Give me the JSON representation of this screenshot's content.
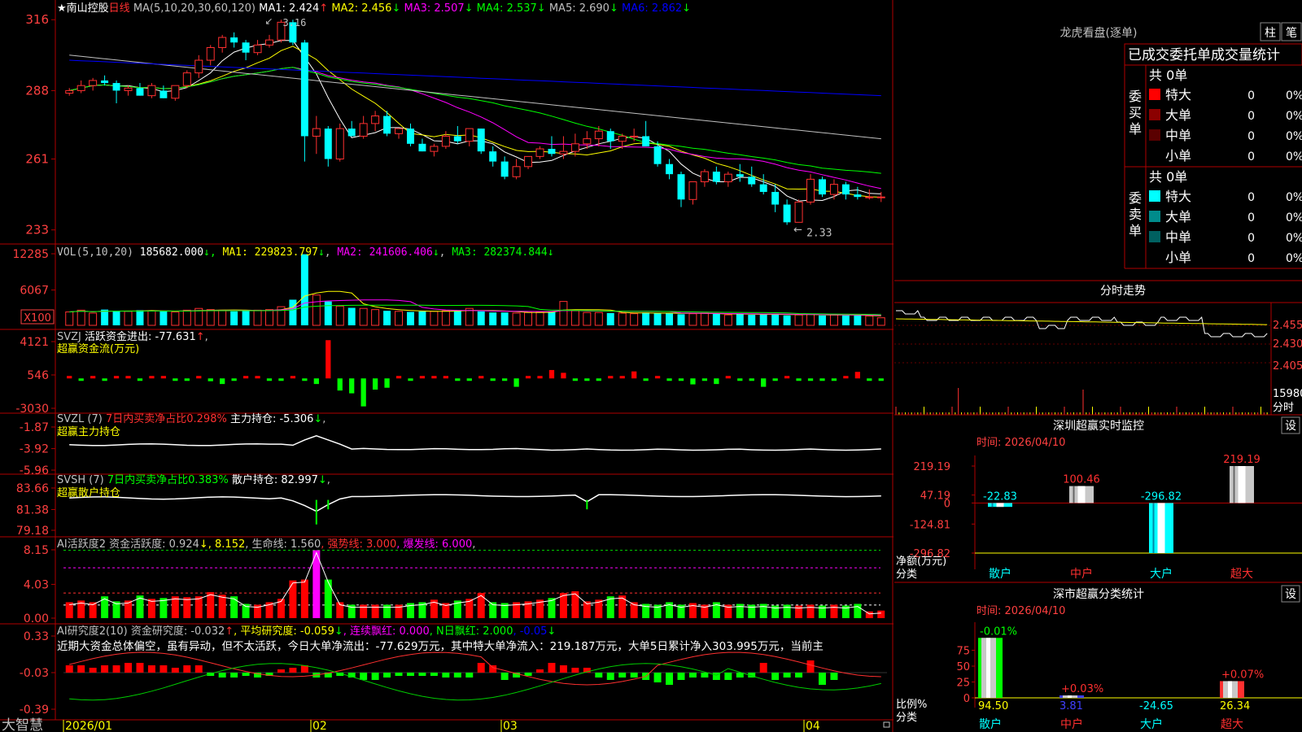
{
  "stock": {
    "name": "南山控股",
    "period": "日线",
    "star": "★"
  },
  "ma_header": {
    "label": "MA(5,10,20,30,60,120)",
    "items": [
      {
        "name": "MA1",
        "value": "2.424",
        "dir": "↑",
        "color": "#ffffff"
      },
      {
        "name": "MA2",
        "value": "2.456",
        "dir": "↓",
        "color": "#ffff00"
      },
      {
        "name": "MA3",
        "value": "2.507",
        "dir": "↓",
        "color": "#ff00ff"
      },
      {
        "name": "MA4",
        "value": "2.537",
        "dir": "↓",
        "color": "#00ff00"
      },
      {
        "name": "MA5",
        "value": "2.690",
        "dir": "↓",
        "color": "#c0c0c0"
      },
      {
        "name": "MA6",
        "value": "2.862",
        "dir": "↓",
        "color": "#0000ff"
      }
    ]
  },
  "price_pane": {
    "y_ticks": [
      "316",
      "288",
      "261",
      "233"
    ],
    "high_label": "3.16",
    "low_label": "2.33"
  },
  "vol_pane": {
    "label": "VOL(5,10,20)",
    "value": "185682.000",
    "ma": [
      {
        "name": "MA1",
        "value": "229823.797",
        "dir": "↓",
        "color": "#ffff00"
      },
      {
        "name": "MA2",
        "value": "241606.406",
        "dir": "↓",
        "color": "#ff00ff"
      },
      {
        "name": "MA3",
        "value": "282374.844",
        "dir": "↓",
        "color": "#00ff00"
      }
    ],
    "y_ticks": [
      "12285",
      "6067"
    ],
    "unit": "X100"
  },
  "svzj_pane": {
    "label": "SVZJ",
    "text": "活跃资金进出: -77.631",
    "dir": "↑",
    "subtitle": "超赢资金流(万元)",
    "y_ticks": [
      "4121",
      "546",
      "-3030"
    ]
  },
  "svzl_pane": {
    "label": "SVZL (7)",
    "text_red": "7日内买卖净占比0.298%",
    "text": "主力持仓: -5.306",
    "dir": "↓",
    "subtitle": "超赢主力持仓",
    "y_ticks": [
      "-1.87",
      "-3.92",
      "-5.96"
    ]
  },
  "svsh_pane": {
    "label": "SVSH (7)",
    "text_green": "7日内买卖净占比0.383%",
    "text": "散户持仓: 82.997",
    "dir": "↓",
    "subtitle": "超赢散户持仓",
    "y_ticks": [
      "83.66",
      "81.38",
      "79.18"
    ]
  },
  "ai_active_pane": {
    "label": "AI活跃度2",
    "items": [
      {
        "text": "资金活跃度: 0.924",
        "color": "#c0c0c0"
      },
      {
        "text": "↓, 8.152",
        "color": "#ffff00"
      },
      {
        "text": ", 生命线: 1.560",
        "color": "#c0c0c0"
      },
      {
        "text": ", 强势线: 3.000",
        "color": "#ff3030"
      },
      {
        "text": ", 爆发线: 6.000",
        "color": "#ff00ff"
      },
      {
        "text": ",",
        "color": "#c0c0c0"
      }
    ],
    "y_ticks": [
      "8.15",
      "4.03",
      "0.00"
    ]
  },
  "ai_research_pane": {
    "label": "AI研究度2(10)",
    "items": [
      {
        "text": "资金研究度: -0.032",
        "color": "#c0c0c0"
      },
      {
        "text": "↑",
        "color": "#ff3030"
      },
      {
        "text": ", 平均研究度: -0.059",
        "color": "#ffff00"
      },
      {
        "text": "↓",
        "color": "#00ff00"
      },
      {
        "text": ", 连续飘红: 0.000",
        "color": "#ff00ff"
      },
      {
        "text": ", N日飘红: 2.000",
        "color": "#00ff00"
      },
      {
        "text": ", -0.05",
        "color": "#0000ff"
      },
      {
        "text": "↓",
        "color": "#00ff00"
      }
    ],
    "commentary": "近期大资金总体偏空，虽有异动，但不太活跃，今日大单净流出：-77.629万元，其中特大单净流入：219.187万元，大单5日累计净入303.995万元，当前主",
    "y_ticks": [
      "0.33",
      "-0.03",
      "-0.39"
    ]
  },
  "x_axis": {
    "labels": [
      "2026/01",
      "02",
      "03",
      "04"
    ],
    "brand": "大智慧"
  },
  "longhu": {
    "title": "龙虎看盘(逐单)",
    "btn_zhu": "柱",
    "btn_bi": "笔",
    "subtitle": "已成交委托单成交量统计",
    "buy": {
      "side": "委买单",
      "total": "共 0单",
      "rows": [
        {
          "label": "特大",
          "count": "0",
          "pct": "0%",
          "color": "#ff0000"
        },
        {
          "label": "大单",
          "count": "0",
          "pct": "0%",
          "color": "#8b0000"
        },
        {
          "label": "中单",
          "count": "0",
          "pct": "0%",
          "color": "#5a0000"
        },
        {
          "label": "小单",
          "count": "0",
          "pct": "0%",
          "color": ""
        }
      ]
    },
    "sell": {
      "side": "委卖单",
      "total": "共 0单",
      "rows": [
        {
          "label": "特大",
          "count": "0",
          "pct": "0%",
          "color": "#00ffff"
        },
        {
          "label": "大单",
          "count": "0",
          "pct": "0%",
          "color": "#008b8b"
        },
        {
          "label": "中单",
          "count": "0",
          "pct": "0%",
          "color": "#006060"
        },
        {
          "label": "小单",
          "count": "0",
          "pct": "0%",
          "color": ""
        }
      ]
    }
  },
  "fenshi": {
    "title": "分时走势",
    "y_ticks": [
      "2.455",
      "2.430",
      "2.405"
    ],
    "vol_label": "15980",
    "fen_label": "分时"
  },
  "sz_monitor": {
    "title": "深圳超赢实时监控",
    "btn": "设",
    "date": "时间: 2026/04/10",
    "y_ticks": [
      "219.19",
      "47.19",
      "0",
      "-124.81",
      "-296.82"
    ],
    "y_unit": "净额(万元)",
    "x_caption": "分类",
    "categories": [
      "散户",
      "中户",
      "大户",
      "超大"
    ],
    "values": [
      -22.83,
      100.46,
      -296.82,
      219.19
    ],
    "value_labels": [
      "-22.83",
      "100.46",
      "-296.82",
      "219.19"
    ]
  },
  "sz_class": {
    "title": "深市超赢分类统计",
    "btn": "设",
    "date": "时间: 2026/04/10",
    "y_ticks": [
      "75",
      "50",
      "25",
      "0"
    ],
    "y_unit": "比例%",
    "x_caption": "分类",
    "categories": [
      "散户",
      "中户",
      "大户",
      "超大"
    ],
    "values": [
      94.5,
      3.81,
      -24.65,
      26.34
    ],
    "value_labels": [
      "94.50",
      "3.81",
      "-24.65",
      "26.34"
    ],
    "change_labels": [
      "-0.01%",
      "+0.03%",
      "",
      "+0.07%"
    ]
  },
  "chart_data": [
    {
      "type": "candlestick",
      "title": "南山控股 日线",
      "ylim": [
        2.3,
        3.18
      ],
      "y_ticks": [
        3.16,
        2.88,
        2.61,
        2.33
      ],
      "x_labels": [
        "2026/01",
        "02",
        "03",
        "04"
      ],
      "ohlc": [
        [
          2.87,
          2.89,
          2.86,
          2.88
        ],
        [
          2.88,
          2.92,
          2.87,
          2.9
        ],
        [
          2.9,
          2.93,
          2.88,
          2.92
        ],
        [
          2.92,
          2.94,
          2.9,
          2.91
        ],
        [
          2.91,
          2.92,
          2.83,
          2.88
        ],
        [
          2.88,
          2.9,
          2.86,
          2.89
        ],
        [
          2.89,
          2.91,
          2.86,
          2.86
        ],
        [
          2.86,
          2.91,
          2.85,
          2.9
        ],
        [
          2.88,
          2.9,
          2.85,
          2.85
        ],
        [
          2.85,
          2.9,
          2.84,
          2.9
        ],
        [
          2.9,
          2.96,
          2.89,
          2.95
        ],
        [
          2.95,
          3.02,
          2.93,
          3.0
        ],
        [
          3.0,
          3.06,
          2.98,
          3.05
        ],
        [
          3.05,
          3.1,
          3.03,
          3.09
        ],
        [
          3.09,
          3.11,
          3.05,
          3.07
        ],
        [
          3.07,
          3.08,
          3.0,
          3.03
        ],
        [
          3.03,
          3.08,
          3.02,
          3.06
        ],
        [
          3.06,
          3.1,
          3.05,
          3.08
        ],
        [
          3.08,
          3.16,
          3.07,
          3.15
        ],
        [
          3.15,
          3.16,
          3.06,
          3.07
        ],
        [
          3.07,
          3.08,
          2.6,
          2.7
        ],
        [
          2.7,
          2.78,
          2.63,
          2.73
        ],
        [
          2.73,
          2.74,
          2.58,
          2.61
        ],
        [
          2.61,
          2.75,
          2.6,
          2.73
        ],
        [
          2.73,
          2.76,
          2.7,
          2.7
        ],
        [
          2.7,
          2.78,
          2.69,
          2.75
        ],
        [
          2.75,
          2.8,
          2.72,
          2.78
        ],
        [
          2.78,
          2.8,
          2.7,
          2.71
        ],
        [
          2.71,
          2.73,
          2.69,
          2.73
        ],
        [
          2.73,
          2.75,
          2.66,
          2.67
        ],
        [
          2.67,
          2.69,
          2.64,
          2.64
        ],
        [
          2.64,
          2.67,
          2.62,
          2.66
        ],
        [
          2.66,
          2.72,
          2.65,
          2.7
        ],
        [
          2.7,
          2.74,
          2.67,
          2.68
        ],
        [
          2.68,
          2.73,
          2.66,
          2.73
        ],
        [
          2.73,
          2.73,
          2.63,
          2.64
        ],
        [
          2.64,
          2.66,
          2.58,
          2.6
        ],
        [
          2.6,
          2.62,
          2.53,
          2.54
        ],
        [
          2.54,
          2.61,
          2.53,
          2.58
        ],
        [
          2.58,
          2.62,
          2.57,
          2.62
        ],
        [
          2.62,
          2.66,
          2.61,
          2.65
        ],
        [
          2.65,
          2.7,
          2.62,
          2.63
        ],
        [
          2.63,
          2.7,
          2.61,
          2.64
        ],
        [
          2.64,
          2.71,
          2.62,
          2.67
        ],
        [
          2.67,
          2.72,
          2.65,
          2.69
        ],
        [
          2.69,
          2.74,
          2.66,
          2.72
        ],
        [
          2.72,
          2.73,
          2.65,
          2.68
        ],
        [
          2.68,
          2.71,
          2.65,
          2.7
        ],
        [
          2.7,
          2.73,
          2.68,
          2.7
        ],
        [
          2.7,
          2.76,
          2.68,
          2.66
        ],
        [
          2.66,
          2.68,
          2.58,
          2.59
        ],
        [
          2.59,
          2.61,
          2.53,
          2.55
        ],
        [
          2.55,
          2.56,
          2.42,
          2.45
        ],
        [
          2.45,
          2.52,
          2.43,
          2.52
        ],
        [
          2.52,
          2.57,
          2.5,
          2.56
        ],
        [
          2.56,
          2.58,
          2.51,
          2.52
        ],
        [
          2.52,
          2.56,
          2.5,
          2.55
        ],
        [
          2.55,
          2.59,
          2.52,
          2.54
        ],
        [
          2.54,
          2.58,
          2.5,
          2.51
        ],
        [
          2.51,
          2.55,
          2.47,
          2.48
        ],
        [
          2.48,
          2.51,
          2.4,
          2.43
        ],
        [
          2.43,
          2.45,
          2.35,
          2.36
        ],
        [
          2.36,
          2.45,
          2.36,
          2.44
        ],
        [
          2.44,
          2.55,
          2.43,
          2.53
        ],
        [
          2.53,
          2.54,
          2.46,
          2.47
        ],
        [
          2.47,
          2.53,
          2.45,
          2.51
        ],
        [
          2.51,
          2.52,
          2.45,
          2.47
        ],
        [
          2.47,
          2.5,
          2.45,
          2.46
        ],
        [
          2.46,
          2.49,
          2.45,
          2.46
        ],
        [
          2.46,
          2.48,
          2.44,
          2.46
        ]
      ],
      "ma": {
        "MA5": {
          "color": "#ffffff"
        },
        "MA10": {
          "color": "#ffff00"
        },
        "MA20": {
          "color": "#ff00ff"
        },
        "MA30": {
          "color": "#00ff00"
        },
        "MA60": {
          "color": "#c0c0c0",
          "start": 3.02,
          "end": 2.69
        },
        "MA120": {
          "color": "#0000ff",
          "start": 3.0,
          "end": 2.86
        }
      },
      "annotations": {
        "high": 3.16,
        "low": 2.33
      }
    },
    {
      "type": "bar",
      "title": "VOL(5,10,20)",
      "unit": "X100",
      "ylim": [
        0,
        12285
      ],
      "y_ticks": [
        12285,
        6067
      ],
      "values": [
        2300,
        2600,
        2100,
        2700,
        2500,
        2400,
        2600,
        2500,
        2400,
        2300,
        2600,
        2900,
        2700,
        2600,
        2400,
        2500,
        2600,
        2700,
        3200,
        4400,
        12200,
        5200,
        4100,
        3300,
        3000,
        2900,
        2700,
        2500,
        2400,
        2300,
        2400,
        2400,
        2500,
        2600,
        2900,
        2400,
        2200,
        2200,
        2100,
        2200,
        2300,
        2400,
        4100,
        2500,
        2200,
        2200,
        2100,
        2100,
        2000,
        2200,
        2100,
        2100,
        1900,
        2000,
        2100,
        2000,
        1800,
        1900,
        1800,
        1900,
        2000,
        1700,
        1800,
        1900,
        1700,
        1800,
        1700,
        1700,
        1600,
        1300
      ],
      "ma": [
        {
          "name": "MA1",
          "color": "#ffff00"
        },
        {
          "name": "MA2",
          "color": "#ff00ff"
        },
        {
          "name": "MA3",
          "color": "#00ff00"
        }
      ]
    },
    {
      "type": "bar",
      "title": "SVZJ 超赢资金流(万元)",
      "ylim": [
        -3030,
        4121
      ],
      "y_ticks": [
        4121,
        546,
        -3030
      ],
      "values": [
        60,
        -60,
        80,
        -80,
        60,
        40,
        -70,
        80,
        60,
        -60,
        -40,
        60,
        -300,
        -600,
        -70,
        60,
        60,
        -80,
        -70,
        60,
        -60,
        -600,
        4100,
        -1300,
        -1600,
        -3000,
        -1200,
        -1000,
        60,
        -80,
        60,
        60,
        50,
        -60,
        -40,
        70,
        -60,
        -70,
        -900,
        60,
        60,
        900,
        600,
        -60,
        -40,
        -60,
        70,
        60,
        750,
        -60,
        60,
        -50,
        -60,
        -640,
        -60,
        -600,
        60,
        -50,
        -50,
        -900,
        -70,
        60,
        -80,
        -60,
        -60,
        -40,
        60,
        700,
        -60,
        -40
      ]
    },
    {
      "type": "line",
      "title": "SVZL 超赢主力持仓",
      "ylim": [
        -5.96,
        -1.87
      ],
      "y_ticks": [
        -1.87,
        -3.92,
        -5.96
      ]
    },
    {
      "type": "line",
      "title": "SVSH 超赢散户持仓",
      "ylim": [
        79.18,
        83.66
      ],
      "y_ticks": [
        83.66,
        81.38,
        79.18
      ]
    },
    {
      "type": "bar",
      "title": "AI活跃度2",
      "ylim": [
        0,
        8.15
      ],
      "y_ticks": [
        8.15,
        4.03,
        0.0
      ],
      "values": [
        1.9,
        2.1,
        1.9,
        2.6,
        2.0,
        2.1,
        2.7,
        2.3,
        2.4,
        2.6,
        2.5,
        2.6,
        3.1,
        2.8,
        2.6,
        1.7,
        1.6,
        1.9,
        2.3,
        4.5,
        4.6,
        8.1,
        4.6,
        1.9,
        1.6,
        1.6,
        1.6,
        1.6,
        1.6,
        1.8,
        1.9,
        2.2,
        1.8,
        2.1,
        2.3,
        3.0,
        1.9,
        1.8,
        1.9,
        2.0,
        2.2,
        2.4,
        3.0,
        3.2,
        2.0,
        2.2,
        2.6,
        2.7,
        1.9,
        1.7,
        1.6,
        1.9,
        1.6,
        1.8,
        1.6,
        1.9,
        1.6,
        1.7,
        1.6,
        1.7,
        1.5,
        1.6,
        1.5,
        1.6,
        1.5,
        1.6,
        1.5,
        1.7,
        0.8,
        0.9
      ],
      "lines": {
        "life": 1.56,
        "strong": 3.0,
        "burst": 6.0
      }
    },
    {
      "type": "bar",
      "title": "AI研究度2(10)",
      "ylim": [
        -0.39,
        0.33
      ],
      "y_ticks": [
        0.33,
        -0.03,
        -0.39
      ],
      "values": [
        0.03,
        0.03,
        0.02,
        0.03,
        0.03,
        0.04,
        0.04,
        0.03,
        0.03,
        0.02,
        0.03,
        0.03,
        -0.01,
        -0.02,
        -0.02,
        -0.01,
        -0.02,
        -0.01,
        0.01,
        0.02,
        0.03,
        -0.02,
        -0.02,
        -0.01,
        -0.02,
        -0.03,
        -0.03,
        -0.02,
        -0.01,
        -0.01,
        -0.01,
        -0.01,
        -0.02,
        -0.02,
        -0.02,
        0.04,
        0.03,
        -0.03,
        -0.02,
        -0.01,
        0.01,
        0.04,
        0.03,
        0.02,
        0.02,
        -0.02,
        -0.03,
        -0.02,
        -0.02,
        -0.03,
        -0.04,
        -0.05,
        -0.03,
        -0.02,
        -0.02,
        -0.03,
        -0.03,
        -0.02,
        -0.02,
        0.04,
        -0.03,
        -0.02,
        -0.02,
        0.05,
        -0.05,
        -0.03
      ]
    }
  ]
}
